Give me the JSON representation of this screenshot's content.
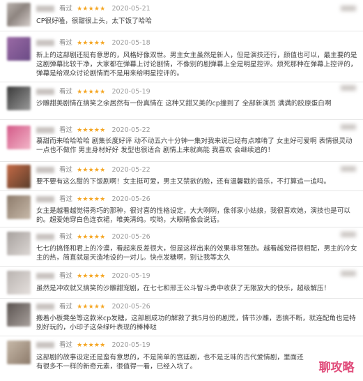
{
  "reviews": [
    {
      "status": "看过",
      "stars": "★★★★★",
      "date": "2020-05-21",
      "text": "CP很好嗑，很甜很上头，太下饭了哈哈"
    },
    {
      "status": "看过",
      "stars": "★★★★★",
      "date": "2020-05-18",
      "text": "新上的这部剧还挺有意思的，风格好像双世。男主女主虽然是新人，但是演技还行，颜值也可以，最主要的是这剧弹幕比较干净，大家都在弹幕上讨论剧情，不像别的剧弹幕上全是明星控评。烦死那种在弹幕上控评的，弹幕是给观众讨论剧情而不是用来给明星控评的。"
    },
    {
      "status": "看过",
      "stars": "★★★★★",
      "date": "2020-05-19",
      "text": "沙雕甜美剧情在搞笑之余居然有一份真情在 这种又甜又美的cp撞到了 全部新演员 满满的胶原蛋白啊"
    },
    {
      "status": "看过",
      "stars": "★★★★★",
      "date": "2020-05-22",
      "text": "慕甜而来哈哈哈哈 剧集长度好评  动不动五六十分钟一集对我来说已经有点难啃了 女主好可爱啊 表情很灵动 一点也不做作  男主身材好好 发型也很适合 剧情上来就高能 我喜欢 会继续追的！"
    },
    {
      "status": "看过",
      "stars": "★★★★★",
      "date": "2020-05-22",
      "text": "要不要有这么甜的下饭剧啊！女主挺可爱，男主又禁欲的脸，还有温馨戳的音乐，不打算追一追吗。"
    },
    {
      "status": "看过",
      "stars": "★★★★★",
      "date": "2020-05-26",
      "text": "女主是越看越觉得秀巧的那种，很讨喜的性格设定，大大咧咧，像邻家小姑娘，我很喜欢她，演技也是可以的。超爱她穿白色连衣裙，唯美清纯。哎哟，大眼睛像会说话。"
    },
    {
      "status": "看过",
      "stars": "★★★★★",
      "date": "2020-05-26",
      "text": "七七的搞怪和君上的冷漠，看起来反差很大，但是这样出来的效果非常强劲。越看越觉得很相配，男主的冷女主的热，简直就是天造地设的一对儿。快点发糖啊，别让我等太久"
    },
    {
      "status": "看过",
      "stars": "★★★★★",
      "date": "2020-05-19",
      "text": "虽然是冲欢就又搞笑的沙雕甜宠剧，在七七和邢王公斗智斗勇中收获了无限放大的快乐，超级解压！"
    },
    {
      "status": "看过",
      "stars": "★★★★★",
      "date": "2020-05-26",
      "text": "搬着小板凳坐等这款米cp发糖，这部剧成功的解救了我5月份的剧荒，情节沙雕，恶搞不断，就连配角也是特别好玩的，小印子这朵绿叶表现的棒棒哒"
    },
    {
      "status": "看过",
      "stars": "★★★★★",
      "date": "2020-05-19",
      "text": "这部剧的故事设定还是蛮有意思的，不是简单的宫廷剧，也不是乏味的古代爱情剧，里面还有很多不一样的新奇元素，很值得一看，已经入坑了。"
    }
  ],
  "watermark": "聊攻略"
}
